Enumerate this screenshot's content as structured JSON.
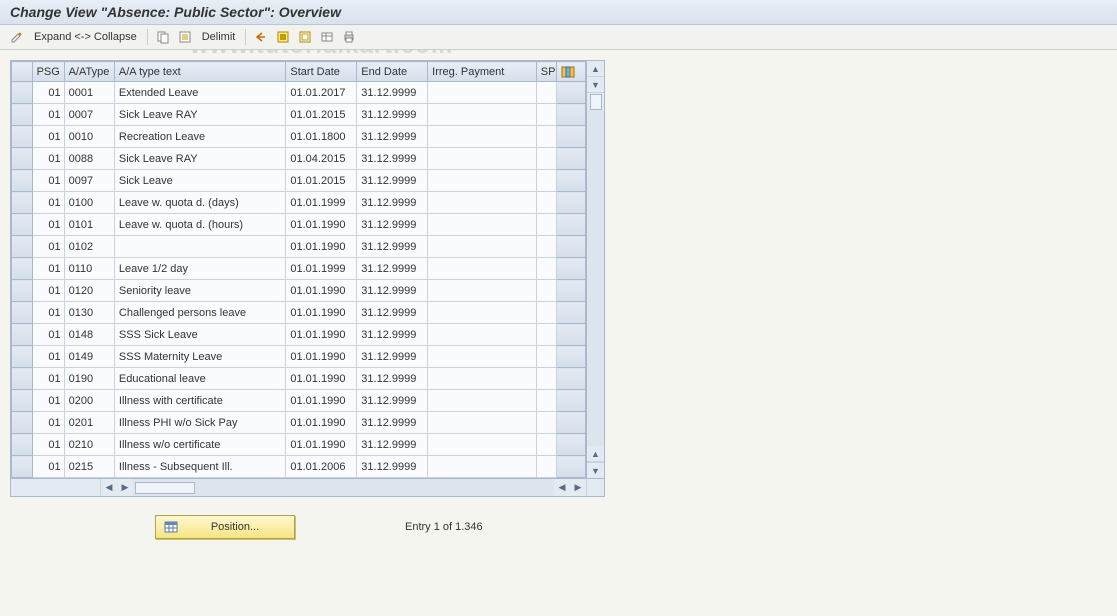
{
  "title": "Change View \"Absence: Public Sector\": Overview",
  "watermark": "www.tutorialkart.com",
  "toolbar": {
    "expand_collapse_label": "Expand <-> Collapse",
    "delimit_label": "Delimit"
  },
  "columns": {
    "psg": "PSG",
    "aatype": "A/AType",
    "text": "A/A type text",
    "start": "Start Date",
    "end": "End Date",
    "irreg": "Irreg. Payment",
    "sp": "SP"
  },
  "rows": [
    {
      "psg": "01",
      "aatype": "0001",
      "text": "Extended Leave",
      "start": "01.01.2017",
      "end": "31.12.9999"
    },
    {
      "psg": "01",
      "aatype": "0007",
      "text": "Sick Leave RAY",
      "start": "01.01.2015",
      "end": "31.12.9999"
    },
    {
      "psg": "01",
      "aatype": "0010",
      "text": "Recreation Leave",
      "start": "01.01.1800",
      "end": "31.12.9999"
    },
    {
      "psg": "01",
      "aatype": "0088",
      "text": "Sick Leave RAY",
      "start": "01.04.2015",
      "end": "31.12.9999"
    },
    {
      "psg": "01",
      "aatype": "0097",
      "text": "Sick Leave",
      "start": "01.01.2015",
      "end": "31.12.9999"
    },
    {
      "psg": "01",
      "aatype": "0100",
      "text": "Leave w. quota d. (days)",
      "start": "01.01.1999",
      "end": "31.12.9999"
    },
    {
      "psg": "01",
      "aatype": "0101",
      "text": "Leave w. quota d. (hours)",
      "start": "01.01.1990",
      "end": "31.12.9999"
    },
    {
      "psg": "01",
      "aatype": "0102",
      "text": "",
      "start": "01.01.1990",
      "end": "31.12.9999"
    },
    {
      "psg": "01",
      "aatype": "0110",
      "text": "Leave 1/2 day",
      "start": "01.01.1999",
      "end": "31.12.9999"
    },
    {
      "psg": "01",
      "aatype": "0120",
      "text": "Seniority leave",
      "start": "01.01.1990",
      "end": "31.12.9999"
    },
    {
      "psg": "01",
      "aatype": "0130",
      "text": "Challenged persons leave",
      "start": "01.01.1990",
      "end": "31.12.9999"
    },
    {
      "psg": "01",
      "aatype": "0148",
      "text": "SSS Sick Leave",
      "start": "01.01.1990",
      "end": "31.12.9999"
    },
    {
      "psg": "01",
      "aatype": "0149",
      "text": "SSS Maternity Leave",
      "start": "01.01.1990",
      "end": "31.12.9999"
    },
    {
      "psg": "01",
      "aatype": "0190",
      "text": "Educational leave",
      "start": "01.01.1990",
      "end": "31.12.9999"
    },
    {
      "psg": "01",
      "aatype": "0200",
      "text": "Illness with certificate",
      "start": "01.01.1990",
      "end": "31.12.9999"
    },
    {
      "psg": "01",
      "aatype": "0201",
      "text": "Illness PHI w/o Sick Pay",
      "start": "01.01.1990",
      "end": "31.12.9999"
    },
    {
      "psg": "01",
      "aatype": "0210",
      "text": "Illness w/o certificate",
      "start": "01.01.1990",
      "end": "31.12.9999"
    },
    {
      "psg": "01",
      "aatype": "0215",
      "text": "Illness - Subsequent Ill.",
      "start": "01.01.2006",
      "end": "31.12.9999"
    }
  ],
  "footer": {
    "position_label": "Position...",
    "entry_text": "Entry 1 of 1.346"
  }
}
